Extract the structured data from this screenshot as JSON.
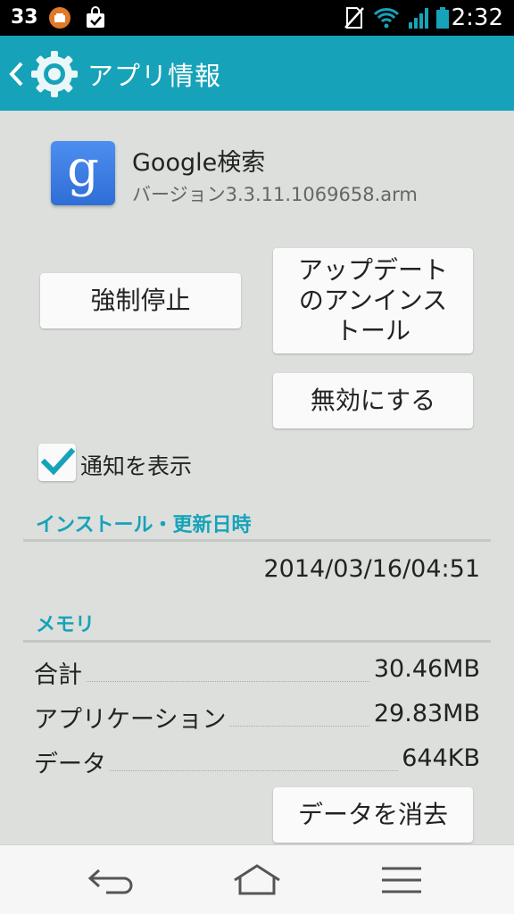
{
  "status_bar": {
    "notification_count": "33",
    "time": "2:32",
    "icons": [
      "orange-circle-icon",
      "shopping-bag-check-icon",
      "no-sim-icon",
      "wifi-icon",
      "signal-icon",
      "battery-icon"
    ]
  },
  "action_bar": {
    "title": "アプリ情報",
    "icons": [
      "back-chevron-icon",
      "gear-icon"
    ]
  },
  "app": {
    "name": "Google検索",
    "version": "バージョン3.3.11.1069658.arm",
    "icon_letter": "g"
  },
  "buttons": {
    "force_stop": "強制停止",
    "uninstall_updates": "アップデート\nのアンインス\nトール",
    "disable": "無効にする",
    "clear_data": "データを消去"
  },
  "notifications": {
    "label": "通知を表示",
    "checked": true
  },
  "install_section": {
    "title": "インストール・更新日時",
    "datetime": "2014/03/16/04:51"
  },
  "memory_section": {
    "title": "メモリ",
    "rows": [
      {
        "label": "合計",
        "value": "30.46MB"
      },
      {
        "label": "アプリケーション",
        "value": "29.83MB"
      },
      {
        "label": "データ",
        "value": "644KB"
      }
    ]
  },
  "nav_bar": {
    "icons": [
      "back-icon",
      "home-icon",
      "menu-icon"
    ]
  },
  "colors": {
    "accent": "#16a3b9",
    "background": "#dcdfdc",
    "status_bar": "#000000",
    "nav_bar": "#f6f6f6"
  }
}
